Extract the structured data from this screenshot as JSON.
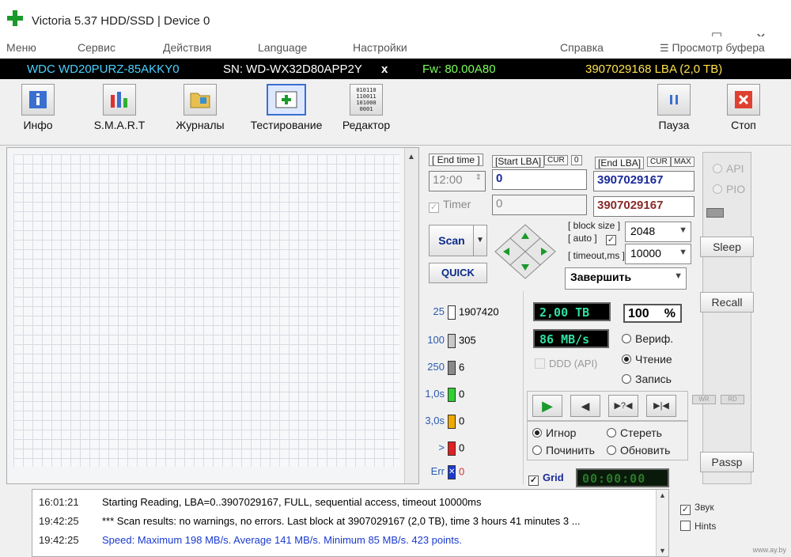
{
  "window": {
    "title": "Victoria 5.37 HDD/SSD | Device 0"
  },
  "menu": [
    "Меню",
    "Сервис",
    "Действия",
    "Language",
    "Настройки",
    "Справка",
    "Просмотр буфера"
  ],
  "device": {
    "model": "WDC WD20PURZ-85AKKY0",
    "serial": "SN: WD-WX32D80APP2Y",
    "close": "x",
    "firmware": "Fw: 80.00A80",
    "capacity": "3907029168 LBA (2,0 TB)"
  },
  "toolbar": {
    "info": "Инфо",
    "smart": "S.M.A.R.T",
    "logs": "Журналы",
    "testing": "Тестирование",
    "editor": "Редактор",
    "editor_icon_text": "010110\n110011\n101000\n0001",
    "pause": "Пауза",
    "stop": "Стоп"
  },
  "scan": {
    "end_time_label": "[ End time ]",
    "end_time_value": "12:00",
    "start_lba_label": "[Start LBA]",
    "cur_label": "CUR",
    "cur_value": "0",
    "start_lba_value": "0",
    "end_lba_label": "[End LBA]",
    "end_cur_label": "CUR",
    "max_label": "MAX",
    "end_lba_value": "3907029167",
    "timer_label": "Timer",
    "timer_value": "0",
    "end_lba_value2": "3907029167",
    "block_size_label": "[ block size ]",
    "auto_label": "[ auto ]",
    "block_size_value": "2048",
    "timeout_label": "[ timeout,ms ]",
    "timeout_value": "10000",
    "scan_button": "Scan",
    "quick_button": "QUICK",
    "finish_action": "Завершить"
  },
  "legend": [
    {
      "threshold": "25",
      "count": "1907420",
      "color": "#ffffff"
    },
    {
      "threshold": "100",
      "count": "305",
      "color": "#c8c8c8"
    },
    {
      "threshold": "250",
      "count": "6",
      "color": "#8a8a8a"
    },
    {
      "threshold": "1,0s",
      "count": "0",
      "color": "#2fd02f"
    },
    {
      "threshold": "3,0s",
      "count": "0",
      "color": "#f0a800"
    },
    {
      "threshold": ">",
      "count": "0",
      "color": "#e02020"
    },
    {
      "threshold": "Err",
      "count": "0",
      "color": "#1a3ad0"
    }
  ],
  "stats": {
    "size": "2,00 TB",
    "percent": "100",
    "percent_sign": "%",
    "speed": "86 MB/s",
    "ddd": "DDD (API)"
  },
  "modes": {
    "verify": "Вериф.",
    "read": "Чтение",
    "write": "Запись",
    "selected": "read"
  },
  "playback": {
    "play": "▶",
    "back": "◀",
    "skip_unknown": "▶?◀",
    "end": "▶|◀"
  },
  "actions": {
    "ignore": "Игнор",
    "erase": "Стереть",
    "repair": "Починить",
    "refresh": "Обновить",
    "selected": "ignore"
  },
  "grid": {
    "label": "Grid",
    "timer": "00:00:00"
  },
  "right": {
    "api": "API",
    "pio": "PIO",
    "sleep": "Sleep",
    "recall": "Recall",
    "passp": "Passp",
    "wr": "WR",
    "rd": "RD"
  },
  "log": [
    {
      "time": "16:01:21",
      "text": "Starting Reading, LBA=0..3907029167, FULL, sequential access, timeout 10000ms",
      "color": "#222222"
    },
    {
      "time": "19:42:25",
      "text": "*** Scan results: no warnings, no errors. Last block at 3907029167 (2,0 TB), time 3 hours 41 minutes 3 ...",
      "color": "#222222"
    },
    {
      "time": "19:42:25",
      "text": "Speed: Maximum 198 MB/s. Average 141 MB/s. Minimum 85 MB/s. 423 points.",
      "color": "#1a3ad0"
    }
  ],
  "options": {
    "sound": "Звук",
    "hints": "Hints"
  },
  "watermark": "www.ay.by"
}
